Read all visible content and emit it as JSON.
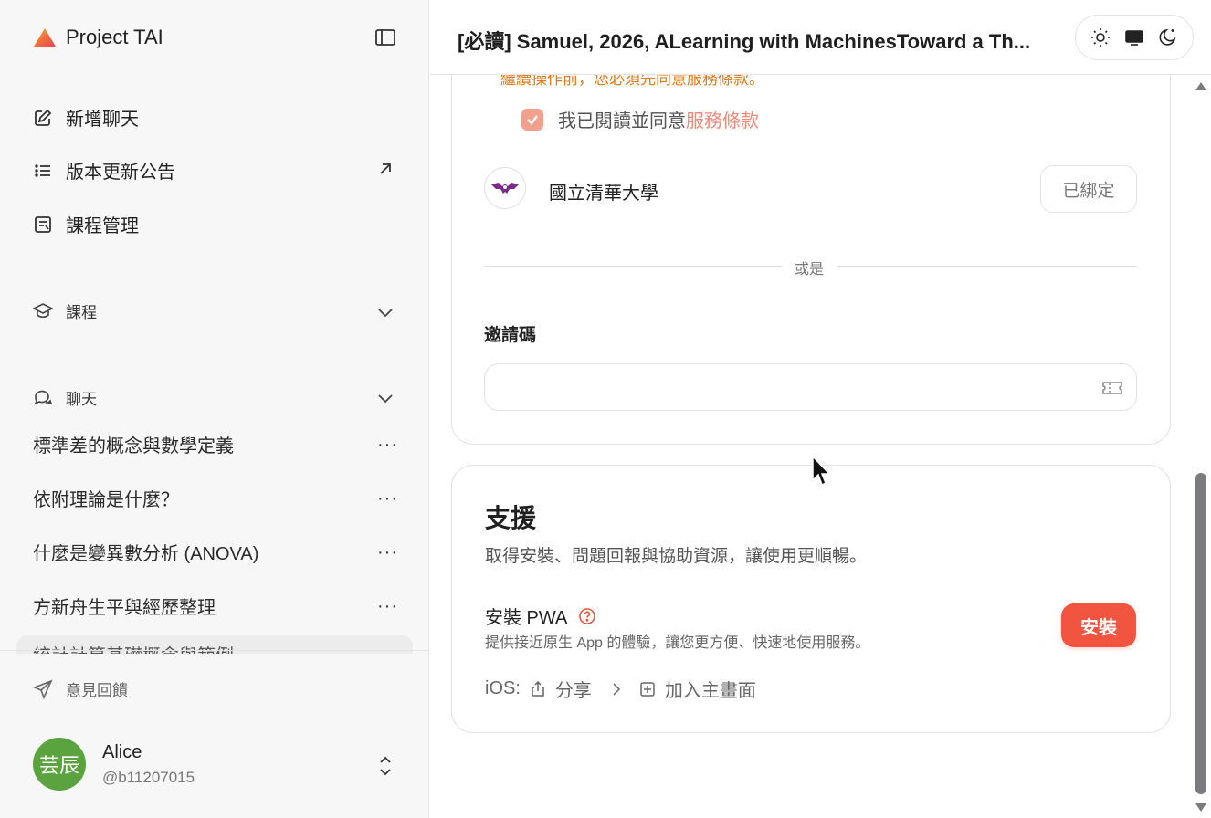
{
  "sidebar": {
    "brand": "Project TAI",
    "nav": [
      {
        "label": "新增聊天",
        "icon": "edit-icon"
      },
      {
        "label": "版本更新公告",
        "icon": "list-icon"
      },
      {
        "label": "課程管理",
        "icon": "manage-icon"
      }
    ],
    "courses_label": "課程",
    "chats_label": "聊天",
    "chats": [
      "標準差的概念與數學定義",
      "依附理論是什麼？",
      "什麼是變異數分析 (ANOVA)",
      "方新舟生平與經歷整理"
    ],
    "chat_partial": "統計計算基礎概念與範例",
    "more_label": "···",
    "feedback": "意見回饋",
    "user": {
      "avatar_text": "芸辰",
      "name": "Alice",
      "handle": "@b11207015"
    }
  },
  "header": {
    "title": "[必讀] Samuel, 2026, ALearning with MachinesToward a Th..."
  },
  "account_card": {
    "warning": "繼續操作前，您必須先同意服務條款。",
    "agree_prefix": "我已閱讀並同意",
    "agree_link": "服務條款",
    "agree_checked": true,
    "university": "國立清華大學",
    "bound_label": "已綁定",
    "or_label": "或是",
    "invite_label": "邀請碼",
    "invite_value": "",
    "invite_placeholder": ""
  },
  "support_card": {
    "title": "支援",
    "description": "取得安裝、問題回報與協助資源，讓使用更順暢。",
    "pwa_title": "安裝 PWA",
    "pwa_description": "提供接近原生 App 的體驗，讓您更方便、快速地使用服務。",
    "install_label": "安裝",
    "ios_label": "iOS:",
    "share_label": "分享",
    "add_home_label": "加入主畫面"
  },
  "colors": {
    "accent": "#f1553f",
    "warning": "#e07b1a",
    "avatar": "#5aa33e",
    "checkbox": "#f2a08e",
    "link": "#ee8a78"
  }
}
